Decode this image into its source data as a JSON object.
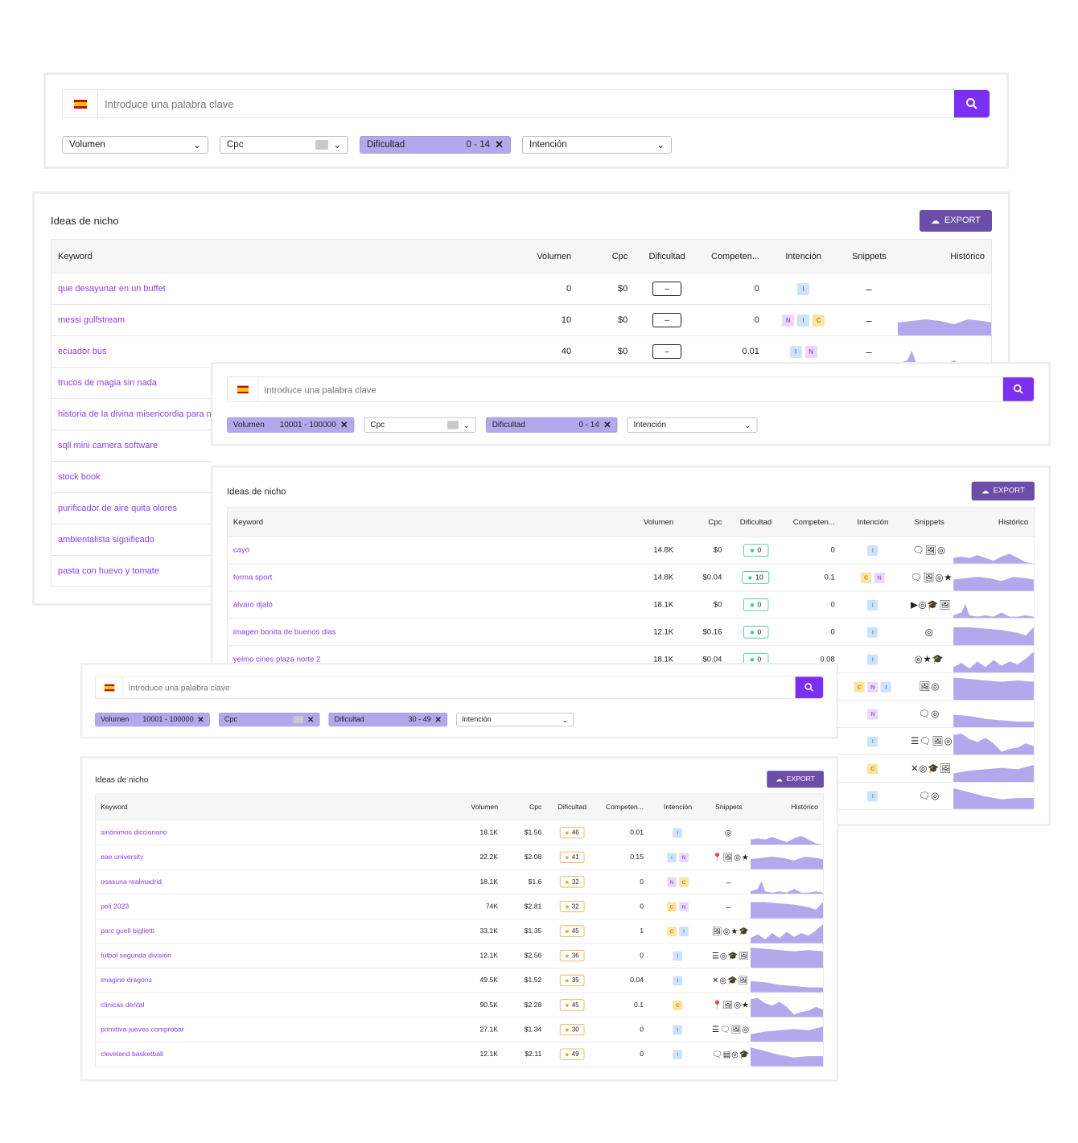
{
  "accent": "#7b2ff0",
  "search": {
    "placeholder": "Introduce una palabra clave"
  },
  "headers": {
    "keyword": "Keyword",
    "volume": "Volumen",
    "cpc": "Cpc",
    "difficulty": "Dificultad",
    "competition": "Competen...",
    "intent": "Intención",
    "snippets": "Snippets",
    "history": "Histórico"
  },
  "export_label": "EXPORT",
  "results_title": "Ideas de nicho",
  "layers": [
    {
      "filters": {
        "volume": "Volumen",
        "volume_range": "",
        "cpc": "Cpc",
        "difficulty": "Dificultad",
        "difficulty_range": "0 - 14",
        "intent": "Intención"
      },
      "rows": [
        {
          "kw": "que desayunar en un buffet",
          "vol": "0",
          "cpc": "$0",
          "diff": "–",
          "comp": "0",
          "intent": [
            "I"
          ],
          "snip": "–"
        },
        {
          "kw": "messi gulfstream",
          "vol": "10",
          "cpc": "$0",
          "diff": "–",
          "comp": "0",
          "intent": [
            "N",
            "I",
            "C"
          ],
          "snip": "–"
        },
        {
          "kw": "ecuador bus",
          "vol": "40",
          "cpc": "$0",
          "diff": "–",
          "comp": "0.01",
          "intent": [
            "I",
            "N"
          ],
          "snip": "–"
        },
        {
          "kw": "trucos de magia sin nada"
        },
        {
          "kw": "historia de la divina misericordia para niños"
        },
        {
          "kw": "sqll mini camera software"
        },
        {
          "kw": "stock book"
        },
        {
          "kw": "purificador de aire quita olores"
        },
        {
          "kw": "ambientalista significado"
        },
        {
          "kw": "pasta con huevo y tomate"
        }
      ]
    },
    {
      "filters": {
        "volume": "Volumen",
        "volume_range": "10001 - 100000",
        "cpc": "Cpc",
        "difficulty": "Dificultad",
        "difficulty_range": "0 - 14",
        "intent": "Intención"
      },
      "rows": [
        {
          "kw": "cayó",
          "vol": "14.8K",
          "cpc": "$0",
          "diff": "0",
          "comp": "0",
          "intent": [
            "I"
          ],
          "snip": "🗨🖼◎"
        },
        {
          "kw": "forma sport",
          "vol": "14.8K",
          "cpc": "$0.04",
          "diff": "10",
          "comp": "0.1",
          "intent": [
            "C",
            "N"
          ],
          "snip": "🗨🖼◎★"
        },
        {
          "kw": "álvaro djaló",
          "vol": "18.1K",
          "cpc": "$0",
          "diff": "0",
          "comp": "0",
          "intent": [
            "I"
          ],
          "snip": "▶◎🎓🖼"
        },
        {
          "kw": "imagen bonita de buenos dias",
          "vol": "12.1K",
          "cpc": "$0.16",
          "diff": "0",
          "comp": "0",
          "intent": [
            "I"
          ],
          "snip": "◎"
        },
        {
          "kw": "yelmo cines plaza norte 2",
          "vol": "18.1K",
          "cpc": "$0.04",
          "diff": "0",
          "comp": "0.08",
          "intent": [
            "I"
          ],
          "snip": "◎★🎓"
        },
        {
          "kw": "",
          "intent": [
            "C",
            "N",
            "I"
          ],
          "snip": "🖼◎"
        },
        {
          "kw": "",
          "intent": [
            "N"
          ],
          "snip": "🗨◎"
        },
        {
          "kw": "",
          "intent": [
            "I"
          ],
          "snip": "☰🗨🖼◎"
        },
        {
          "kw": "",
          "intent": [
            "C"
          ],
          "snip": "✕◎🎓🖼"
        },
        {
          "kw": "",
          "intent": [
            "I"
          ],
          "snip": "🗨◎"
        }
      ]
    },
    {
      "filters": {
        "volume": "Volumen",
        "volume_range": "10001 - 100000",
        "cpc": "Cpc",
        "difficulty": "Dificultad",
        "difficulty_range": "30 - 49",
        "intent": "Intención"
      },
      "rows": [
        {
          "kw": "sinónimos diccionario",
          "vol": "18.1K",
          "cpc": "$1.56",
          "diff": "46",
          "comp": "0.01",
          "intent": [
            "I"
          ],
          "snip": "◎"
        },
        {
          "kw": "eae university",
          "vol": "22.2K",
          "cpc": "$2.08",
          "diff": "41",
          "comp": "0.15",
          "intent": [
            "I",
            "N"
          ],
          "snip": "📍🖼◎★"
        },
        {
          "kw": "osasuna realmadrid",
          "vol": "18.1K",
          "cpc": "$1.6",
          "diff": "32",
          "comp": "0",
          "intent": [
            "N",
            "C"
          ],
          "snip": "–"
        },
        {
          "kw": "peli 2023",
          "vol": "74K",
          "cpc": "$2.81",
          "diff": "32",
          "comp": "0",
          "intent": [
            "C",
            "N"
          ],
          "snip": "–"
        },
        {
          "kw": "parc guell biglietti",
          "vol": "33.1K",
          "cpc": "$1.35",
          "diff": "45",
          "comp": "1",
          "intent": [
            "C",
            "I"
          ],
          "snip": "🖼◎★🎓"
        },
        {
          "kw": "fútbol segunda división",
          "vol": "12.1K",
          "cpc": "$2.56",
          "diff": "36",
          "comp": "0",
          "intent": [
            "I"
          ],
          "snip": "☰◎🎓🖼"
        },
        {
          "kw": "imagine dragons",
          "vol": "49.5K",
          "cpc": "$1.52",
          "diff": "35",
          "comp": "0.04",
          "intent": [
            "I"
          ],
          "snip": "✕◎🎓🖼"
        },
        {
          "kw": "clinicas dental",
          "vol": "90.5K",
          "cpc": "$2.28",
          "diff": "45",
          "comp": "0.1",
          "intent": [
            "C"
          ],
          "snip": "📍🖼◎★"
        },
        {
          "kw": "primitiva-jueves comprobar",
          "vol": "27.1K",
          "cpc": "$1.34",
          "diff": "30",
          "comp": "0",
          "intent": [
            "I"
          ],
          "snip": "☰🗨🖼◎"
        },
        {
          "kw": "cleveland basketball",
          "vol": "12.1K",
          "cpc": "$2.11",
          "diff": "49",
          "comp": "0",
          "intent": [
            "I"
          ],
          "snip": "🗨▤◎🎓"
        }
      ]
    }
  ]
}
